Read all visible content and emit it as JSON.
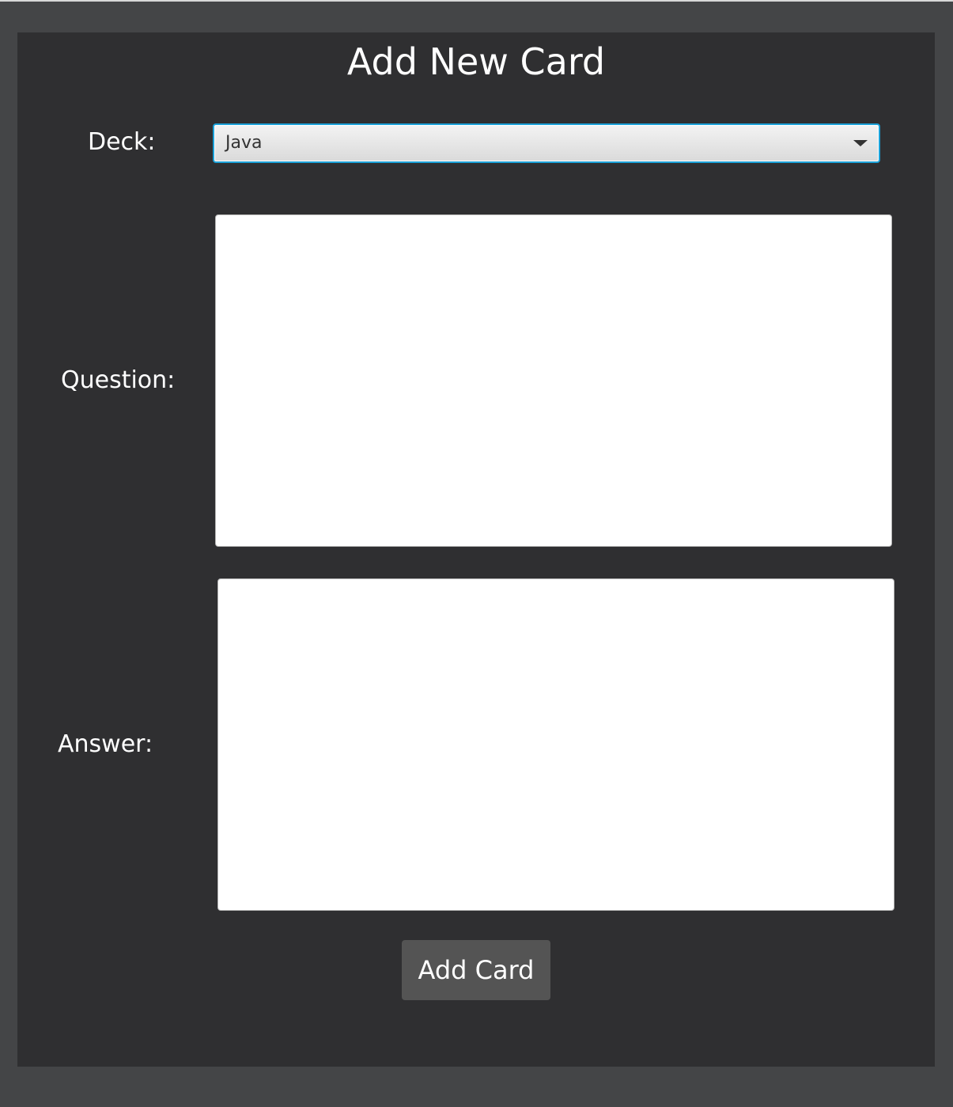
{
  "dialog": {
    "title": "Add New Card"
  },
  "deck": {
    "label": "Deck:",
    "selected": "Java",
    "icon": "chevron-down-icon"
  },
  "question": {
    "label": "Question:",
    "value": ""
  },
  "answer": {
    "label": "Answer:",
    "value": ""
  },
  "actions": {
    "add_card_label": "Add Card"
  },
  "colors": {
    "panel_background": "#2f2f31",
    "frame_background": "#444547",
    "focus_border": "#1ba1d8",
    "button_background": "#545454",
    "text": "#ffffff"
  }
}
